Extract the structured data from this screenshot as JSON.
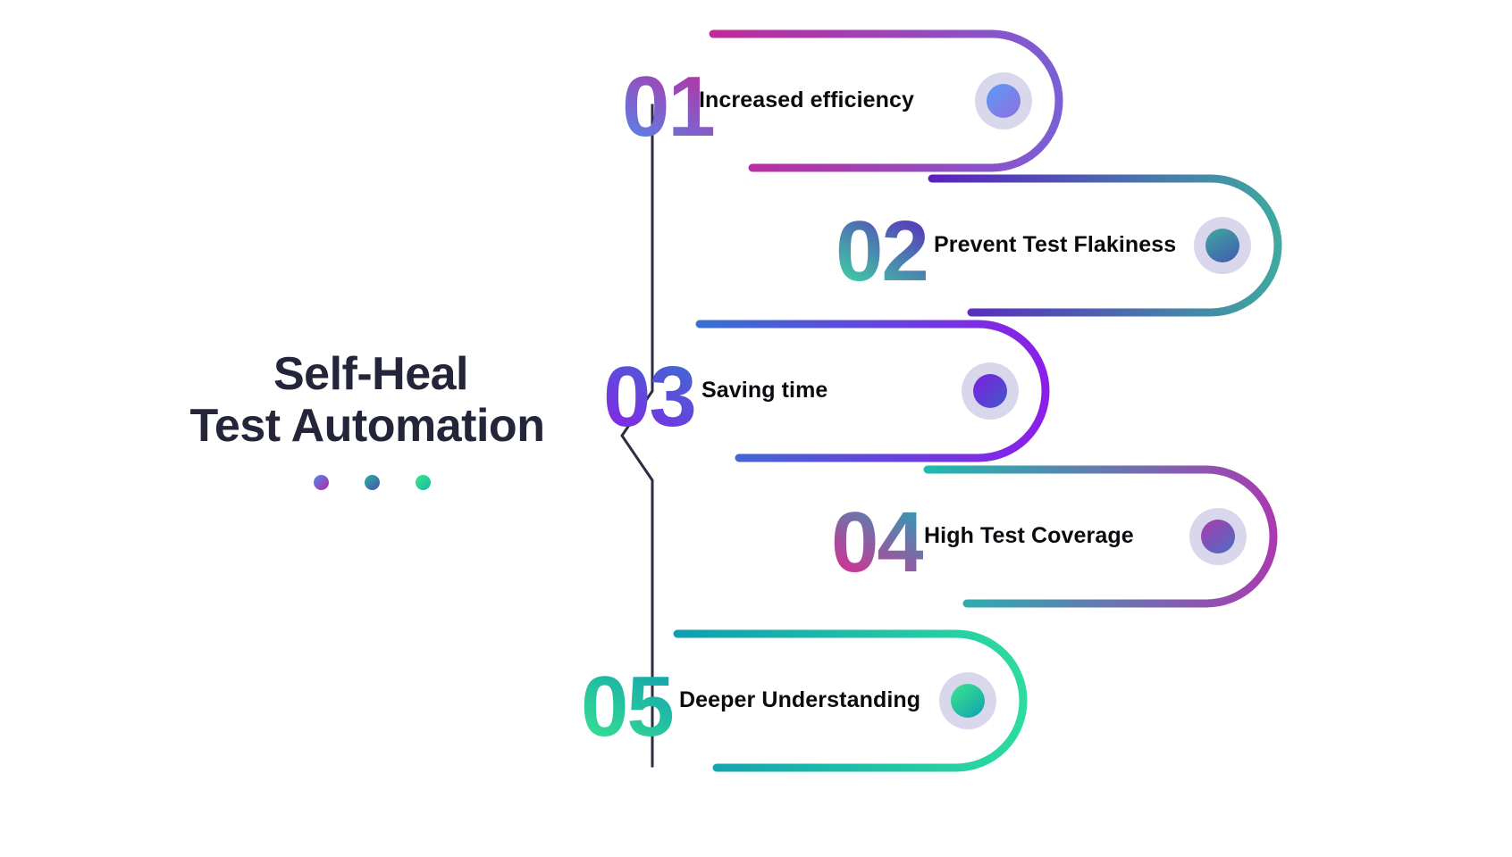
{
  "title": {
    "line1": "Self-Heal",
    "line2": "Test Automation",
    "dots": [
      {
        "name": "dot-blue-magenta",
        "from": "#4f8bf0",
        "to": "#b32aa0"
      },
      {
        "name": "dot-teal-indigo",
        "from": "#2bb39a",
        "to": "#4a4fb0"
      },
      {
        "name": "dot-green-teal",
        "from": "#3ce68f",
        "to": "#16b8a0"
      }
    ],
    "color": "#242539"
  },
  "spine": {
    "color": "#2b2d42",
    "shape": "vertical-line-with-left-chevron"
  },
  "items": [
    {
      "number": "01",
      "label": "Increased efficiency",
      "number_gradient": {
        "from": "#4f8bf0",
        "to": "#bf2a9a"
      },
      "pill_gradient": {
        "from": "#bf2a9a",
        "to": "#7b5fd4"
      },
      "node_gradient": {
        "from": "#5b9bf5",
        "to": "#8f6fe0"
      },
      "halo": "#d9d7ec"
    },
    {
      "number": "02",
      "label": "Prevent Test Flakiness",
      "number_gradient": {
        "from": "#3ce6a0",
        "to": "#5b21c0"
      },
      "pill_gradient": {
        "from": "#5b21c0",
        "to": "#3fa8a0"
      },
      "node_gradient": {
        "from": "#3fa8a0",
        "to": "#4358b0"
      },
      "halo": "#d9d7ec"
    },
    {
      "number": "03",
      "label": "Saving time",
      "number_gradient": {
        "from": "#8b1fe8",
        "to": "#3a6fd0"
      },
      "pill_gradient": {
        "from": "#3a6fd0",
        "to": "#8b1fe8"
      },
      "node_gradient": {
        "from": "#7b1fe0",
        "to": "#4358c8"
      },
      "halo": "#d9d7ec"
    },
    {
      "number": "04",
      "label": "High Test Coverage",
      "number_gradient": {
        "from": "#ee1f8f",
        "to": "#1fa8b8"
      },
      "pill_gradient": {
        "from": "#1fbaae",
        "to": "#a93bb0"
      },
      "node_gradient": {
        "from": "#a93bb0",
        "to": "#4a6fc0"
      },
      "halo": "#d9d7ec"
    },
    {
      "number": "05",
      "label": "Deeper Understanding",
      "number_gradient": {
        "from": "#3ce68f",
        "to": "#0f9fb0"
      },
      "pill_gradient": {
        "from": "#0f9fb0",
        "to": "#2ddba0"
      },
      "node_gradient": {
        "from": "#3ce68f",
        "to": "#0fa0b0"
      },
      "halo": "#d9d7ec"
    }
  ]
}
